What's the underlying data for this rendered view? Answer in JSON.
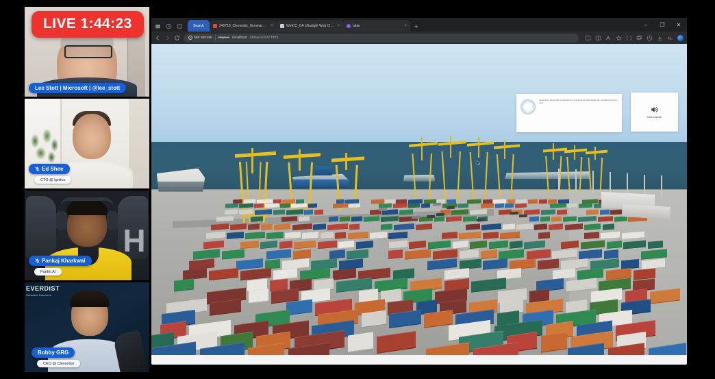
{
  "live": {
    "label": "LIVE 1:44:23"
  },
  "participants": [
    {
      "name": "Lee Stott | Microsoft | @lee_stott",
      "subtitle": "",
      "muted": false,
      "logo": "",
      "logo_sub": ""
    },
    {
      "name": "Ed Shee",
      "subtitle": "CTO @ Ignitus",
      "muted": true,
      "logo": "",
      "logo_sub": ""
    },
    {
      "name": "Pankaj Kharkwal",
      "subtitle": "Pankh.AI",
      "muted": true,
      "logo": "",
      "logo_sub": ""
    },
    {
      "name": "Bobby GRG",
      "subtitle": "CEO @ Cleverdist",
      "muted": false,
      "logo": "EVERDIST",
      "logo_sub": "Software Solutions"
    }
  ],
  "browser": {
    "tabs": [
      {
        "label": "Search",
        "active": true,
        "favicon_color": "#2f5fb5",
        "close": ""
      },
      {
        "label": "240719_Cleverdist_Seminar_AI_...",
        "active": false,
        "favicon_color": "#d9443c",
        "close": "×"
      },
      {
        "label": "WinCC_OA Ultralight Web Client",
        "active": false,
        "favicon_color": "#c9ccd0",
        "close": "×"
      },
      {
        "label": "table",
        "active": false,
        "favicon_color": "#8b5cf6",
        "close": "×"
      }
    ],
    "new_tab": "+",
    "window_controls": {
      "minimize": "–",
      "maximize": "❐",
      "close": "✕"
    },
    "address": {
      "security_label": "Not secure",
      "security_icon": "ⓧ",
      "scheme": "https://",
      "host": "localhost",
      "path": "/data/ulc/ulc.html"
    }
  },
  "scene": {
    "info_panel_text": "Cleverdist / Global 3D visualisation for a Smart Port 2030 digital twin simulation runtime view",
    "speak_button_label": "Hold to speak",
    "speak_icon": "speaker-icon"
  },
  "colors": {
    "live_red": "#f0322e",
    "nameplate_blue": "#1560d8",
    "tab_active_blue": "#2f5fb5",
    "sky": "#cfe4f3",
    "sea": "#2f5f78",
    "quay": "#b2b2ae",
    "crane_yellow": "#e6c020"
  }
}
